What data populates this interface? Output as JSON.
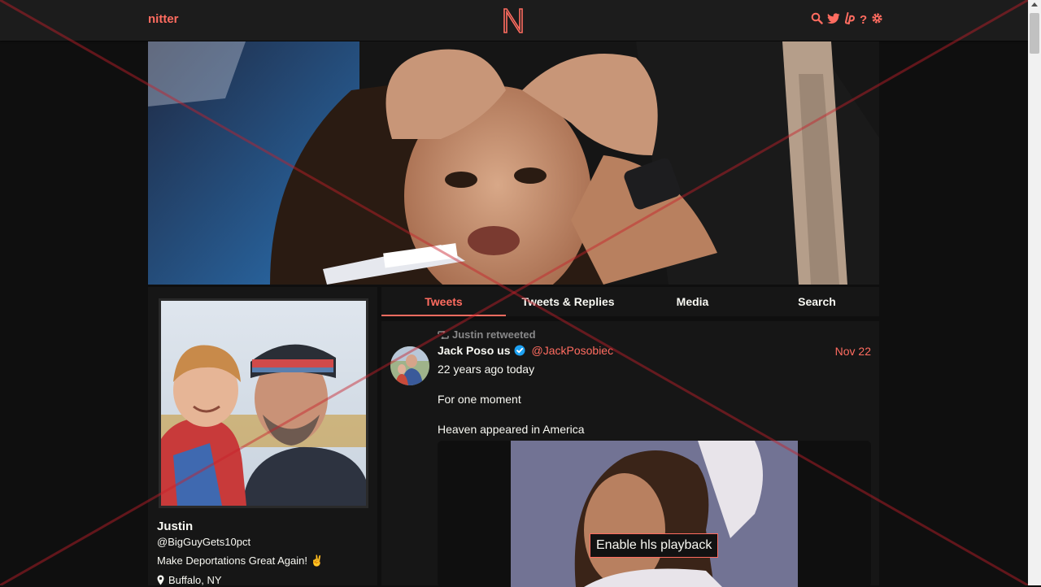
{
  "header": {
    "brand": "nitter",
    "logo_letter": "N",
    "icons": [
      "search-icon",
      "twitter-icon",
      "liberapay-icon",
      "help-icon",
      "settings-icon"
    ],
    "help_glyph": "?"
  },
  "profile": {
    "fullname": "Justin",
    "username": "@BigGuyGets10pct",
    "bio": "Make Deportations Great Again! ✌️",
    "location": "Buffalo, NY"
  },
  "tabs": [
    {
      "label": "Tweets",
      "active": true
    },
    {
      "label": "Tweets & Replies",
      "active": false
    },
    {
      "label": "Media",
      "active": false
    },
    {
      "label": "Search",
      "active": false
    }
  ],
  "tweet": {
    "retweet_header": "Justin retweeted",
    "fullname": "Jack Poso us",
    "username": "@JackPosobiec",
    "date": "Nov 22",
    "lines": [
      "22 years ago today",
      "For one moment",
      "Heaven appeared in America"
    ],
    "media_button": "Enable hls playback"
  },
  "colors": {
    "accent": "#ff6c60",
    "background": "#0f0f0f",
    "panel": "#161616",
    "text": "#f8f8f2",
    "muted": "#888889"
  }
}
